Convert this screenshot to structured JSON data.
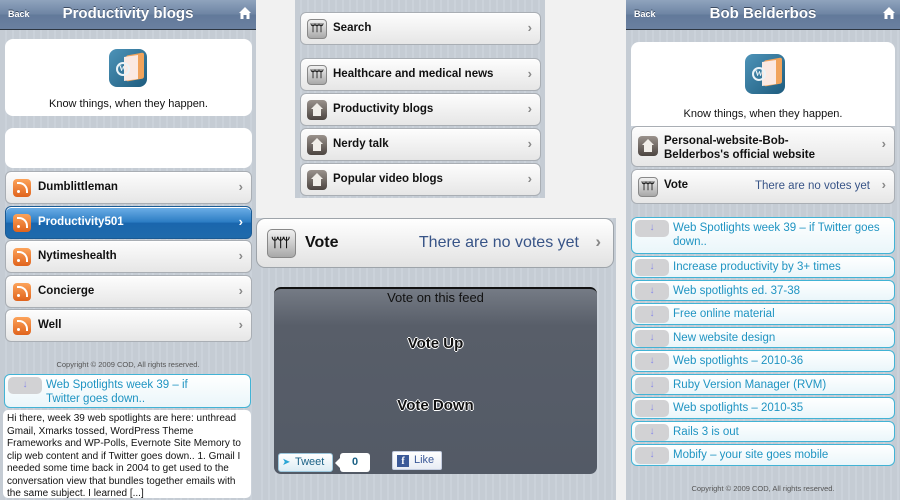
{
  "left_panel": {
    "nav": {
      "back": "Back",
      "title": "Productivity blogs",
      "home_icon": "home-icon"
    },
    "tagline": "Know things, when they happen.",
    "feeds": [
      {
        "label": "Dumblittleman",
        "icon": "rss-icon",
        "selected": false
      },
      {
        "label": "Productivity501",
        "icon": "rss-icon",
        "selected": true
      },
      {
        "label": "Nytimeshealth",
        "icon": "rss-icon",
        "selected": false
      },
      {
        "label": "Concierge",
        "icon": "rss-icon",
        "selected": false
      },
      {
        "label": "Well",
        "icon": "rss-icon",
        "selected": false
      }
    ],
    "copyright": "Copyright © 2009 COD, All rights reserved.",
    "post": {
      "title": "Web Spotlights week 39 – if Twitter goes down..",
      "excerpt": "Hi there, week 39 web spotlights are here: unthread Gmail, Xmarks tossed, WordPress Theme Frameworks and WP-Polls, Evernote Site Memory to clip web content and if Twitter goes down.. 1. Gmail I needed some time back in 2004 to get used to the conversation view that bundles together emails with the same subject. I learned [...]"
    }
  },
  "middle_top_panel": {
    "search": {
      "label": "Search",
      "icon": "people-icon"
    },
    "categories": [
      {
        "label": "Healthcare and medical news",
        "icon": "people-icon"
      },
      {
        "label": "Productivity blogs",
        "icon": "house-icon"
      },
      {
        "label": "Nerdy talk",
        "icon": "house-icon"
      },
      {
        "label": "Popular video blogs",
        "icon": "house-icon"
      }
    ]
  },
  "middle_bottom_panel": {
    "vote_row": {
      "label": "Vote",
      "status": "There are no votes yet"
    },
    "vote_box": {
      "title": "Vote on this feed",
      "vote_up": "Vote Up",
      "vote_down": "Vote Down",
      "tweet_label": "Tweet",
      "tweet_count": "0",
      "like_label": "Like"
    }
  },
  "right_panel": {
    "nav": {
      "back": "Back",
      "title": "Bob Belderbos",
      "home_icon": "home-icon"
    },
    "tagline": "Know things, when they happen.",
    "website_row": {
      "label_line1": "Personal-website-Bob-",
      "label_line2": "Belderbos's official website"
    },
    "vote_row": {
      "label": "Vote",
      "status": "There are no votes yet"
    },
    "posts": [
      "Web Spotlights week 39 – if Twitter goes down..",
      "Increase productivity by 3+ times",
      "Web spotlights ed. 37-38",
      "Free online material",
      "New website design",
      "Web spotlights – 2010-36",
      "Ruby Version Manager (RVM)",
      "Web spotlights – 2010-35",
      "Rails 3 is out",
      "Mobify – your site goes mobile"
    ],
    "copyright": "Copyright © 2009 COD, All rights reserved."
  },
  "colors": {
    "navbar": "#6d84a3",
    "selected_row": "#2a7bc2",
    "post_link": "#1f94c2",
    "vote_status": "#385487",
    "rss": "#e0631c",
    "vote_box": "#535a66"
  }
}
